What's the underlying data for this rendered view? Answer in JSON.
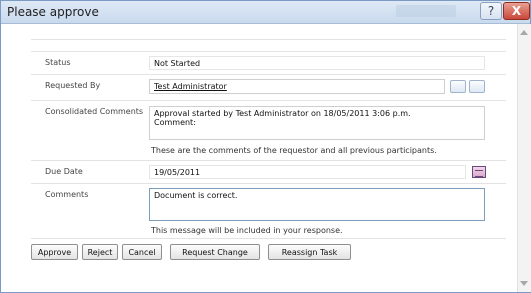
{
  "window": {
    "title": "Please approve"
  },
  "form": {
    "status": {
      "label": "Status",
      "value": "Not Started"
    },
    "requested_by": {
      "label": "Requested By",
      "value": "Test Administrator"
    },
    "consolidated_comments": {
      "label": "Consolidated Comments",
      "text_line1": "Approval started by Test Administrator on 18/05/2011 3:06 p.m.",
      "text_line2": "Comment:",
      "help": "These are the comments of the requestor and all previous participants."
    },
    "due_date": {
      "label": "Due Date",
      "value": "19/05/2011"
    },
    "comments": {
      "label": "Comments",
      "value": "Document is correct.",
      "help": "This message will be included in your response."
    }
  },
  "buttons": {
    "approve": "Approve",
    "reject": "Reject",
    "cancel": "Cancel",
    "request_change": "Request Change",
    "reassign_task": "Reassign Task"
  },
  "titlebar_icons": {
    "help": "?",
    "close": "X"
  }
}
